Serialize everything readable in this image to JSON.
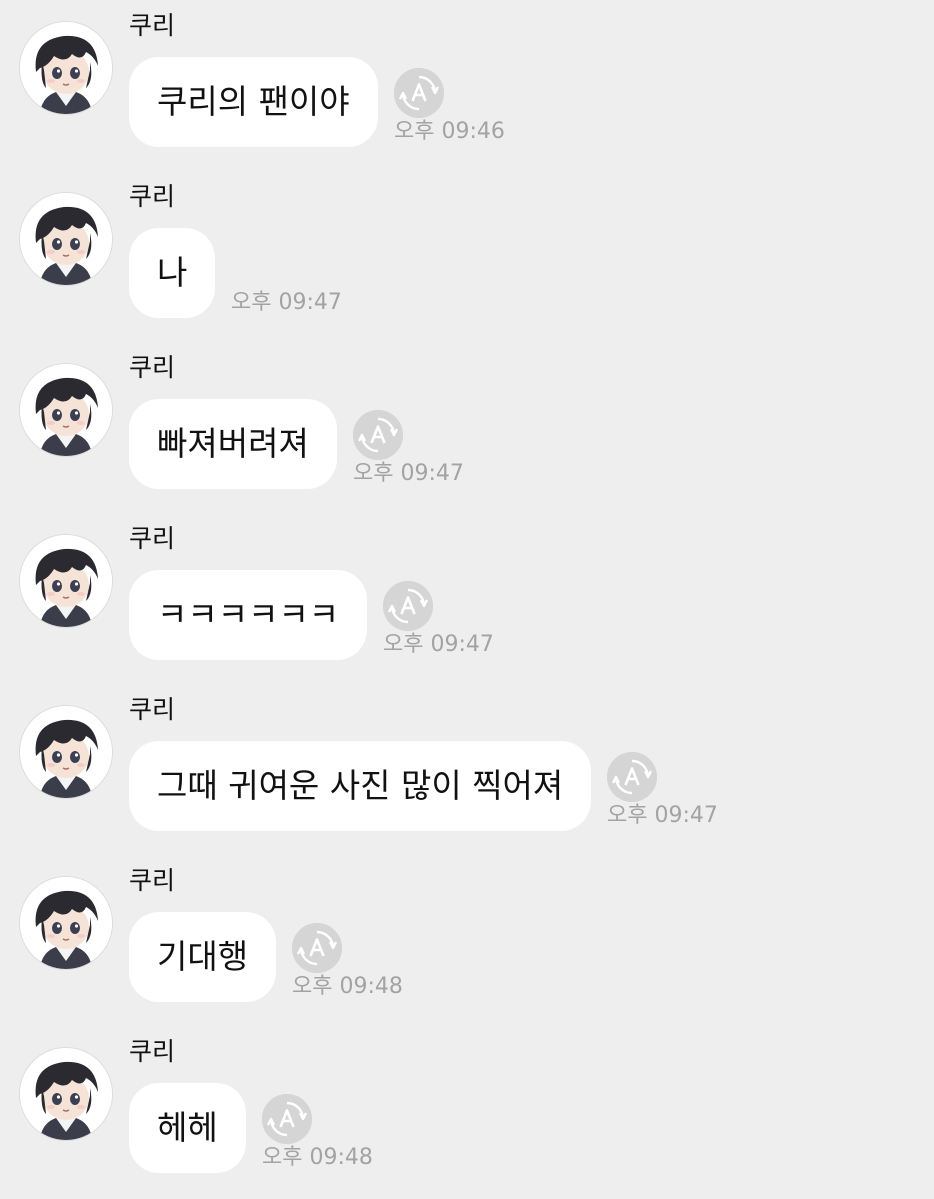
{
  "colors": {
    "background": "#eeeeee",
    "bubble": "#ffffff",
    "timestamp": "#a3a3a3",
    "translate_button": "#d5d5d5"
  },
  "icons": {
    "avatar": "profile-avatar-illustration",
    "translate": "auto-translate-icon"
  },
  "messages": [
    {
      "sender": "쿠리",
      "text": "쿠리의 팬이야",
      "time": "오후 09:46",
      "translate_button": true
    },
    {
      "sender": "쿠리",
      "text": "나",
      "time": "오후 09:47",
      "translate_button": false
    },
    {
      "sender": "쿠리",
      "text": "빠져버려져",
      "time": "오후 09:47",
      "translate_button": true
    },
    {
      "sender": "쿠리",
      "text": "ㅋㅋㅋㅋㅋㅋ",
      "time": "오후 09:47",
      "translate_button": true
    },
    {
      "sender": "쿠리",
      "text": "그때 귀여운 사진 많이 찍어져",
      "time": "오후 09:47",
      "translate_button": true
    },
    {
      "sender": "쿠리",
      "text": "기대행",
      "time": "오후 09:48",
      "translate_button": true
    },
    {
      "sender": "쿠리",
      "text": "헤헤",
      "time": "오후 09:48",
      "translate_button": true
    }
  ]
}
